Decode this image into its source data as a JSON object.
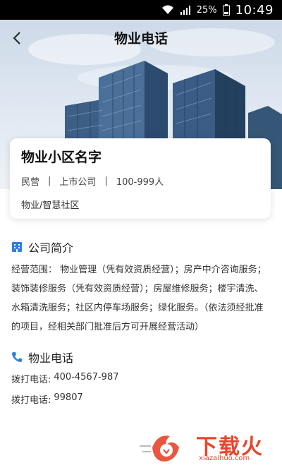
{
  "status_bar": {
    "battery_percent": "25%",
    "time": "10:49"
  },
  "nav": {
    "title": "物业电话"
  },
  "company": {
    "name": "物业小区名字",
    "ownership": "民营",
    "listing": "上市公司",
    "size": "100-999人",
    "industry": "物业/智慧社区"
  },
  "intro": {
    "title": "公司简介",
    "text": "经营范围： 物业管理（凭有效资质经营）；房产中介咨询服务；装饰装修服务（凭有效资质经营）；房屋维修服务；楼宇清洗、水箱清洗服务；社区内停车场服务；绿化服务。（依法须经批准的项目，经相关部门批准后方可开展经营活动）"
  },
  "phones": {
    "title": "物业电话",
    "items": [
      {
        "label": "拨打电话:",
        "number": "400-4567-987"
      },
      {
        "label": "拨打电话:",
        "number": "99807"
      }
    ]
  },
  "watermark": {
    "brand": "下载火",
    "url": "xiazaihuo.com"
  },
  "colors": {
    "accent_blue": "#2f7fe0",
    "watermark_red": "#e8452b"
  }
}
